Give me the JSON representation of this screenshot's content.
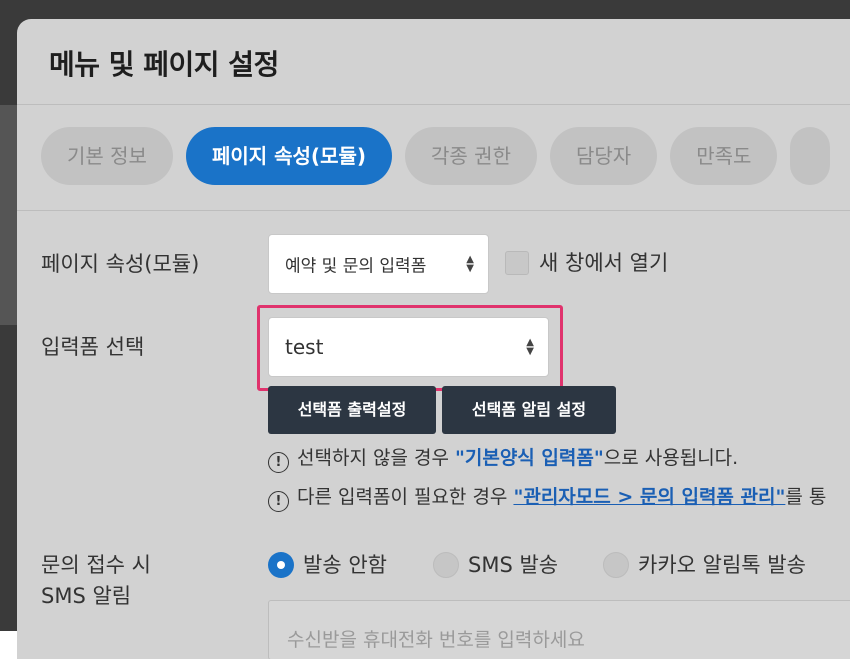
{
  "modal": {
    "title": "메뉴 및 페이지 설정",
    "tabs": [
      {
        "label": "기본 정보",
        "active": false
      },
      {
        "label": "페이지 속성(모듈)",
        "active": true
      },
      {
        "label": "각종 권한",
        "active": false
      },
      {
        "label": "담당자",
        "active": false
      },
      {
        "label": "만족도",
        "active": false
      },
      {
        "label": "",
        "active": false
      }
    ]
  },
  "page_attribute": {
    "label": "페이지 속성(모듈)",
    "selected": "예약 및 문의 입력폼",
    "new_window_label": "새 창에서 열기"
  },
  "form_select": {
    "label": "입력폼 선택",
    "selected": "test",
    "output_settings_button": "선택폼 출력설정",
    "alert_settings_button": "선택폼 알림 설정",
    "notes": [
      {
        "icon": "info-icon",
        "before": "선택하지 않을 경우 ",
        "emphasis": "\"기본양식 입력폼\"",
        "after": "으로 사용됩니다."
      },
      {
        "icon": "info-icon",
        "before": "다른 입력폼이 필요한 경우 ",
        "link": "\"관리자모드 > 문의 입력폼 관리\"",
        "after": "를 통"
      }
    ]
  },
  "sms_notify": {
    "label_line1": "문의 접수 시",
    "label_line2": "SMS 알림",
    "options": [
      {
        "label": "발송 안함",
        "selected": true
      },
      {
        "label": "SMS 발송",
        "selected": false
      },
      {
        "label": "카카오 알림톡 발송",
        "selected": false
      }
    ],
    "phone_placeholder": "수신받을 휴대전화 번호를 입력하세요"
  },
  "colors": {
    "accent": "#1a73c8",
    "highlight": "#e0336d",
    "dark_button": "#2c3642",
    "link": "#1a5fb4"
  }
}
